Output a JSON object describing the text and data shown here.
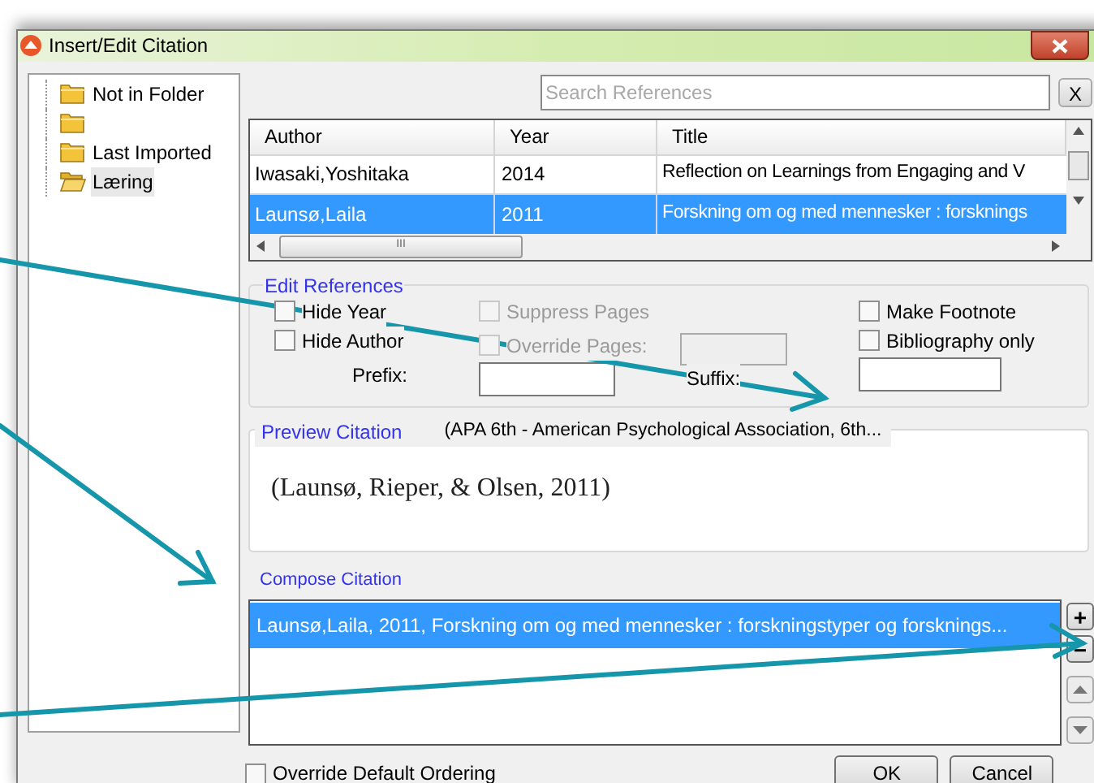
{
  "window": {
    "title": "Insert/Edit Citation"
  },
  "folders": [
    {
      "label": "Not in Folder",
      "open": false,
      "selected": false
    },
    {
      "open": false,
      "selected": false
    },
    {
      "label": "Last Imported",
      "open": false,
      "selected": false
    },
    {
      "label": "Læring",
      "open": true,
      "selected": true
    }
  ],
  "search": {
    "placeholder": "Search References",
    "clear": "X"
  },
  "table": {
    "columns": [
      "Author",
      "Year",
      "Title"
    ],
    "rows": [
      {
        "author": "Iwasaki,Yoshitaka",
        "year": "2014",
        "title": "Reflection on Learnings from Engaging and V",
        "selected": false
      },
      {
        "author": "Launsø,Laila",
        "year": "2011",
        "title": "Forskning om og med mennesker : forsknings",
        "selected": true
      }
    ],
    "hscroll_thumb": "III"
  },
  "edit_references": {
    "legend": "Edit References",
    "options": [
      {
        "label": "Hide Year",
        "checked": false,
        "disabled": false
      },
      {
        "label": "Hide Author",
        "checked": false,
        "disabled": false
      },
      {
        "label": "Suppress Pages",
        "checked": false,
        "disabled": true
      },
      {
        "label": "Override Pages:",
        "checked": false,
        "disabled": true
      },
      {
        "label": "Make Footnote",
        "checked": false,
        "disabled": false
      },
      {
        "label": "Bibliography only",
        "checked": false,
        "disabled": false
      }
    ],
    "prefix": "Prefix:",
    "suffix": "Suffix:"
  },
  "preview": {
    "legend": "Preview Citation",
    "style": "(APA 6th - American Psychological Association, 6th...",
    "text": "(Launsø, Rieper, & Olsen, 2011)"
  },
  "compose": {
    "legend": "Compose Citation",
    "items": [
      {
        "text": "Launsø,Laila, 2011, Forskning om og med mennesker : forskningstyper og forsknings...",
        "selected": true
      }
    ],
    "add": "+",
    "remove": "−"
  },
  "override_ordering": {
    "label": "Override Default Ordering",
    "checked": false
  },
  "buttons": [
    "OK",
    "Cancel"
  ]
}
